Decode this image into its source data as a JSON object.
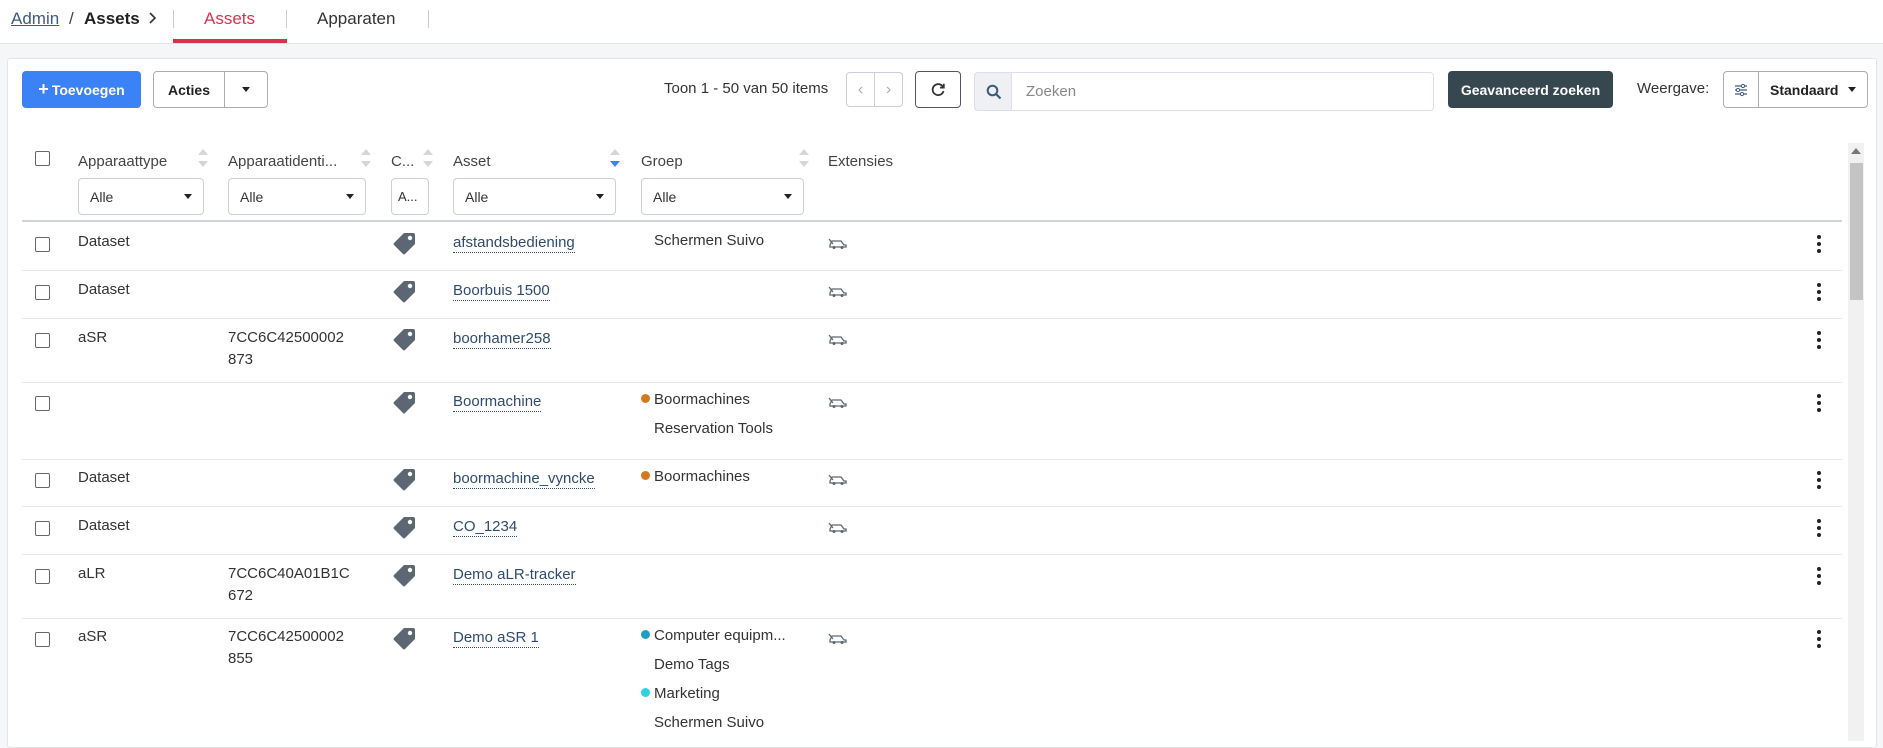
{
  "breadcrumb": {
    "admin": "Admin",
    "separator": "/",
    "current": "Assets"
  },
  "tabs": [
    {
      "label": "Assets",
      "active": true
    },
    {
      "label": "Apparaten",
      "active": false
    }
  ],
  "toolbar": {
    "add_label": "Toevoegen",
    "actions_label": "Acties",
    "counter": "Toon 1 - 50 van 50 items",
    "search_placeholder": "Zoeken",
    "advanced_search_label": "Geavanceerd zoeken",
    "view_label": "Weergave:",
    "view_value": "Standaard"
  },
  "table": {
    "columns": [
      {
        "label": "Apparaattype",
        "filter": "Alle"
      },
      {
        "label": "Apparaatidenti...",
        "filter": "Alle"
      },
      {
        "label": "C...",
        "filter": "A..."
      },
      {
        "label": "Asset",
        "filter": "Alle"
      },
      {
        "label": "Groep",
        "filter": "Alle"
      },
      {
        "label": "Extensies"
      }
    ],
    "rows": [
      {
        "type": "Dataset",
        "id_line1": "",
        "id_line2": "",
        "asset": "afstandsbediening",
        "groups": [
          {
            "name": "Schermen Suivo",
            "color": ""
          }
        ],
        "has_ext": true
      },
      {
        "type": "Dataset",
        "id_line1": "",
        "id_line2": "",
        "asset": "Boorbuis 1500",
        "groups": [],
        "has_ext": true
      },
      {
        "type": "aSR",
        "id_line1": "7CC6C42500002",
        "id_line2": "873",
        "asset": "boorhamer258",
        "groups": [],
        "has_ext": true
      },
      {
        "type": "",
        "id_line1": "",
        "id_line2": "",
        "asset": "Boormachine",
        "groups": [
          {
            "name": "Boormachines",
            "color": "#d4791e"
          },
          {
            "name": "Reservation Tools",
            "color": ""
          }
        ],
        "has_ext": true
      },
      {
        "type": "Dataset",
        "id_line1": "",
        "id_line2": "",
        "asset": "boormachine_vyncke",
        "groups": [
          {
            "name": "Boormachines",
            "color": "#d4791e"
          }
        ],
        "has_ext": true
      },
      {
        "type": "Dataset",
        "id_line1": "",
        "id_line2": "",
        "asset": "CO_1234",
        "groups": [],
        "has_ext": true
      },
      {
        "type": "aLR",
        "id_line1": "7CC6C40A01B1C",
        "id_line2": "672",
        "asset": "Demo aLR-tracker",
        "groups": [],
        "has_ext": false
      },
      {
        "type": "aSR",
        "id_line1": "7CC6C42500002",
        "id_line2": "855",
        "asset": "Demo aSR 1",
        "groups": [
          {
            "name": "Computer equipm...",
            "color": "#1e9fc2"
          },
          {
            "name": "Demo Tags",
            "color": ""
          },
          {
            "name": "Marketing",
            "color": "#2dd4e0"
          },
          {
            "name": "Schermen Suivo",
            "color": ""
          }
        ],
        "has_ext": true
      }
    ]
  },
  "colors": {
    "accent_red": "#d9324a",
    "primary_blue": "#3b82f6",
    "dark_button": "#37474f"
  }
}
